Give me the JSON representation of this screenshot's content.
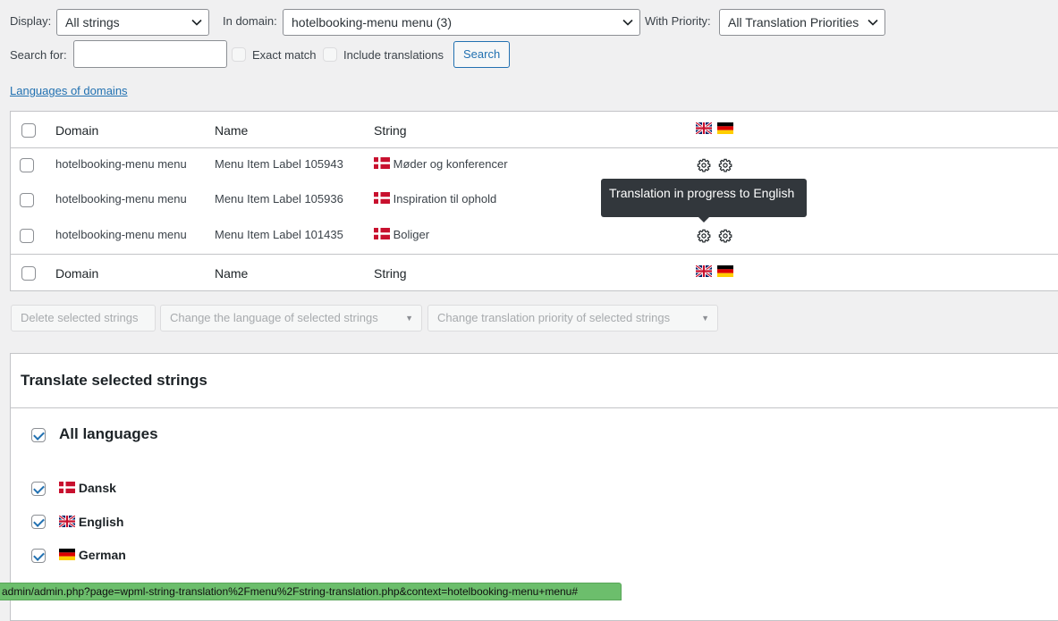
{
  "filters": {
    "display_label": "Display:",
    "display_value": "All strings",
    "domain_label": "In domain:",
    "domain_value": "hotelbooking-menu menu (3)",
    "priority_label": "With Priority:",
    "priority_value": "All Translation Priorities",
    "search_label": "Search for:",
    "search_value": "",
    "exact_match_label": "Exact match",
    "include_translations_label": "Include translations",
    "search_button": "Search",
    "languages_link": "Languages of domains"
  },
  "table": {
    "columns": [
      "Domain",
      "Name",
      "String"
    ],
    "rows": [
      {
        "domain": "hotelbooking-menu menu",
        "name": "Menu Item Label 105943",
        "string": "Møder og konferencer"
      },
      {
        "domain": "hotelbooking-menu menu",
        "name": "Menu Item Label 105936",
        "string": "Inspiration til ophold"
      },
      {
        "domain": "hotelbooking-menu menu",
        "name": "Menu Item Label 101435",
        "string": "Boliger"
      }
    ]
  },
  "tooltip": "Translation in progress to English",
  "bulk_actions": {
    "delete": "Delete selected strings",
    "change_language": "Change the language of selected strings",
    "change_priority": "Change translation priority of selected strings"
  },
  "translate_panel": {
    "title": "Translate selected strings",
    "all_languages": "All languages",
    "languages": [
      "Dansk",
      "English",
      "German"
    ]
  },
  "status_url": "admin/admin.php?page=wpml-string-translation%2Fmenu%2Fstring-translation.php&context=hotelbooking-menu+menu#",
  "colors": {
    "accent": "#2271b1",
    "tooltip_bg": "#32373c",
    "status_bar": "#6cbe6c"
  }
}
